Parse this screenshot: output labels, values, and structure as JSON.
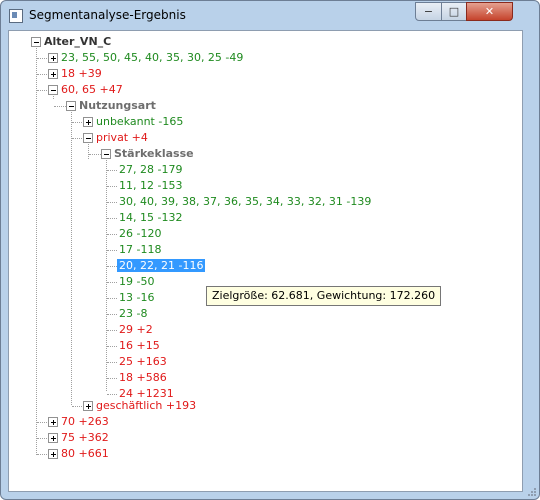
{
  "window": {
    "title": "Segmentanalyse-Ergebnis",
    "controls": {
      "minimize": "−",
      "maximize": "□",
      "close": "✕"
    }
  },
  "tree": {
    "root": "Alter_VN_C",
    "level1": [
      {
        "label": "23, 55, 50, 45, 40, 35, 30, 25  -49",
        "color": "green",
        "expanded": false
      },
      {
        "label": "18  +39",
        "color": "red",
        "expanded": false
      },
      {
        "label": "60, 65  +47",
        "color": "red",
        "expanded": true
      },
      {
        "label": "70  +263",
        "color": "red",
        "expanded": false
      },
      {
        "label": "75  +362",
        "color": "red",
        "expanded": false
      },
      {
        "label": "80  +661",
        "color": "red",
        "expanded": false
      }
    ],
    "nutzungsart": {
      "label": "Nutzungsart",
      "children": [
        {
          "label": "unbekannt  -165",
          "color": "green"
        },
        {
          "label": "privat  +4",
          "color": "red"
        },
        {
          "label": "geschäftlich  +193",
          "color": "red"
        }
      ]
    },
    "staerkeklasse": {
      "label": "Stärkeklasse",
      "leaves": [
        {
          "label": "27, 28  -179",
          "color": "green"
        },
        {
          "label": "11, 12  -153",
          "color": "green"
        },
        {
          "label": "30, 40, 39, 38, 37, 36, 35, 34, 33, 32, 31  -139",
          "color": "green"
        },
        {
          "label": "14, 15  -132",
          "color": "green"
        },
        {
          "label": "26  -120",
          "color": "green"
        },
        {
          "label": "17  -118",
          "color": "green"
        },
        {
          "label": "20, 22, 21  -116",
          "color": "green",
          "selected": true
        },
        {
          "label": "19  -50",
          "color": "green"
        },
        {
          "label": "13  -16",
          "color": "green"
        },
        {
          "label": "23  -8",
          "color": "green"
        },
        {
          "label": "29  +2",
          "color": "red"
        },
        {
          "label": "16  +15",
          "color": "red"
        },
        {
          "label": "25  +163",
          "color": "red"
        },
        {
          "label": "18  +586",
          "color": "red"
        },
        {
          "label": "24  +1231",
          "color": "red"
        }
      ]
    }
  },
  "tooltip": "Zielgröße: 62.681, Gewichtung: 172.260",
  "colors": {
    "positive": "#e01919",
    "negative": "#1f8a1f",
    "selection": "#3399ff",
    "tooltip_bg": "#ffffe1"
  }
}
